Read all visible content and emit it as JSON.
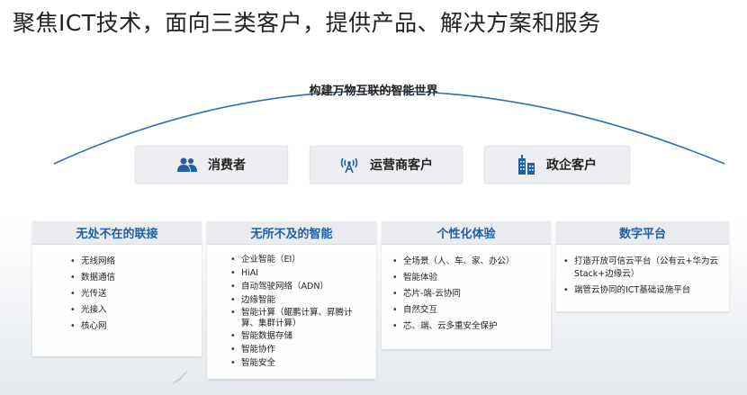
{
  "title": "聚焦ICT技术，面向三类客户，提供产品、解决方案和服务",
  "subtitle": "构建万物互联的智能世界",
  "customers": [
    {
      "label": "消费者",
      "icon": "users-icon"
    },
    {
      "label": "运营商客户",
      "icon": "antenna-tower-icon"
    },
    {
      "label": "政企客户",
      "icon": "buildings-icon"
    }
  ],
  "columns": [
    {
      "header": "无处不在的联接",
      "items": [
        "无线网络",
        "数据通信",
        "光传送",
        "光接入",
        "核心网"
      ]
    },
    {
      "header": "无所不及的智能",
      "items": [
        "企业智能（EI）",
        "HiAI",
        "自动驾驶网络（ADN）",
        "边缘智能",
        "智能计算（鲲鹏计算、昇腾计算、集群计算）",
        "智能数据存储",
        "智能协作",
        "智能安全"
      ]
    },
    {
      "header": "个性化体验",
      "items": [
        "全场景（人、车、家、办公）",
        "智能体验",
        "芯片-端-云协同",
        "自然交互",
        "芯、端、云多重安全保护"
      ]
    },
    {
      "header": "数字平台",
      "items": [
        "打造开放可信云平台（公有云+华为云Stack+边缘云）",
        "端管云协同的ICT基础设施平台"
      ]
    }
  ],
  "colors": {
    "accent": "#1f5fa7",
    "arc": "#2e6db4"
  }
}
